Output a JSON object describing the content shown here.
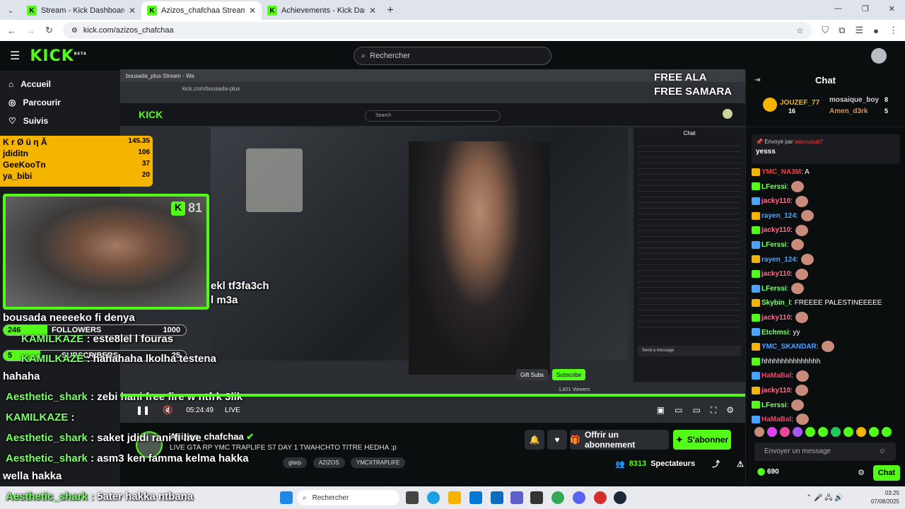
{
  "browser": {
    "tabs": [
      {
        "label": "Stream - Kick Dashboard"
      },
      {
        "label": "Azizos_chafchaa Stream - Watc"
      },
      {
        "label": "Achievements - Kick Dashboard"
      }
    ],
    "url": "kick.com/azizos_chafchaa"
  },
  "header": {
    "logo": "KICK",
    "logo_sup": "BETA",
    "search_placeholder": "Rechercher"
  },
  "sidebar": {
    "nav": [
      {
        "label": "Accueil",
        "icon": "home-icon"
      },
      {
        "label": "Parcourir",
        "icon": "compass-icon"
      },
      {
        "label": "Suivis",
        "icon": "heart-icon"
      }
    ]
  },
  "overlay": {
    "leaderboard_title": "K r Ø ü η Ă",
    "leaderboard": [
      {
        "name": "K r Ø ü η Ă",
        "value": "145.35"
      },
      {
        "name": "jdiditn",
        "value": "106"
      },
      {
        "name": "GeeKooTn",
        "value": "37"
      },
      {
        "name": "ya_bibi",
        "value": "20"
      }
    ],
    "webcam_count": "81",
    "followers_count": "246",
    "followers_label": "FOLLOWERS",
    "followers_goal": "1000",
    "subscribers_count": "5",
    "subscribers_label": "SUBSCRIBERS",
    "subscribers_goal": "25",
    "chat_lines": [
      {
        "user": "",
        "text": "bousada neeeeko fi denya"
      },
      {
        "user": "KAMILKAZE",
        "text": " : este8lel l fouras"
      },
      {
        "user": "KAMILKAZE",
        "text": " : hahahaha lkolha testena"
      },
      {
        "user": "",
        "text": "hahaha"
      },
      {
        "user": "Aesthetic_shark",
        "text": " : zebi hani free fire w ntfrk 3lik"
      },
      {
        "user": "KAMILKAZE",
        "text": " : "
      },
      {
        "user": "Aesthetic_shark",
        "text": " : saket jdidi rani fi live"
      },
      {
        "user": "Aesthetic_shark",
        "text": " : asm3 ken famma kelma hakka"
      },
      {
        "user": "",
        "text": "wella hakka"
      },
      {
        "user": "Aesthetic_shark",
        "text": " : 5ater hakka ntbana"
      }
    ],
    "free_line1": "FREE ALA",
    "free_line2": "FREE SAMARA",
    "in_video_text1": "ekl tf3fa3ch",
    "in_video_text2": "l m3a"
  },
  "inner_stream": {
    "tab": "bousada_plus Stream - Wa",
    "url": "kick.com/bousada-plus",
    "search": "Search",
    "chat_title": "Chat",
    "chat_input": "Send a message",
    "gift_subs": "Gift Subs",
    "subscribe": "Subscribe",
    "viewers": "1,821 Viewers"
  },
  "player": {
    "time": "05:24:49",
    "live": "LIVE"
  },
  "stream": {
    "channel": "Azizos_chafchaa",
    "title": "LIVE GTA RP YMC TRAPLIFE S7 DAY 1   TWAHCHTO TITRE HEDHA :p",
    "tags": [
      "gtarp",
      "AZIZOS",
      "YMCXTRAPLIFE"
    ],
    "subscribe_offer": "Offrir un abonnement",
    "subscribe": "S'abonner",
    "viewers_count": "8313",
    "viewers_label": "Spectateurs"
  },
  "chat": {
    "title": "Chat",
    "gifters": [
      {
        "name": "JOUZEF_77",
        "count": "16"
      },
      {
        "name": "mosaique_boy",
        "count": "8"
      },
      {
        "name": "Amen_d3rk",
        "count": "5"
      }
    ],
    "pinned_by": "Envoyé par",
    "pinned_user": "wayousub7",
    "pinned_text": "yesss",
    "messages": [
      {
        "user": "YMC_NA3M",
        "color": "#ff3b3b",
        "text": ": A"
      },
      {
        "user": "LFerssi",
        "color": "#7dff6a",
        "text": ":"
      },
      {
        "user": "jacky110",
        "color": "#ff6b8a",
        "text": ":"
      },
      {
        "user": "rayen_124",
        "color": "#4aa3ff",
        "text": ":"
      },
      {
        "user": "jacky110",
        "color": "#ff6b8a",
        "text": ":"
      },
      {
        "user": "LFerssi",
        "color": "#7dff6a",
        "text": ":"
      },
      {
        "user": "rayen_124",
        "color": "#4aa3ff",
        "text": ":"
      },
      {
        "user": "jacky110",
        "color": "#ff6b8a",
        "text": ":"
      },
      {
        "user": "LFerssi",
        "color": "#7dff6a",
        "text": ":"
      },
      {
        "user": "Skybin_l",
        "color": "#7dff6a",
        "text": ": FREEEE PALESTINEEEEE"
      },
      {
        "user": "jacky110",
        "color": "#ff6b8a",
        "text": ":"
      },
      {
        "user": "Etchmsi",
        "color": "#7dff6a",
        "text": ": yy"
      },
      {
        "user": "YMC_SKANDAR",
        "color": "#4aa3ff",
        "text": ":"
      },
      {
        "user": "",
        "color": "#ffffff",
        "text": "hhhhhhhhhhhhhhh"
      },
      {
        "user": "HaMaBal",
        "color": "#ff3b6b",
        "text": ":"
      },
      {
        "user": "jacky110",
        "color": "#ff6b8a",
        "text": ":"
      },
      {
        "user": "LFerssi",
        "color": "#7dff6a",
        "text": ":"
      },
      {
        "user": "HaMaBal",
        "color": "#ff3b6b",
        "text": ":"
      }
    ],
    "input_placeholder": "Envoyer un message",
    "points": "690",
    "send": "Chat"
  },
  "taskbar": {
    "search": "Rechercher",
    "time": "03:25",
    "date": "07/08/2025"
  },
  "colors": {
    "accent": "#53fc18",
    "background": "#0b0e0f",
    "leaderboard": "#f5b400"
  }
}
